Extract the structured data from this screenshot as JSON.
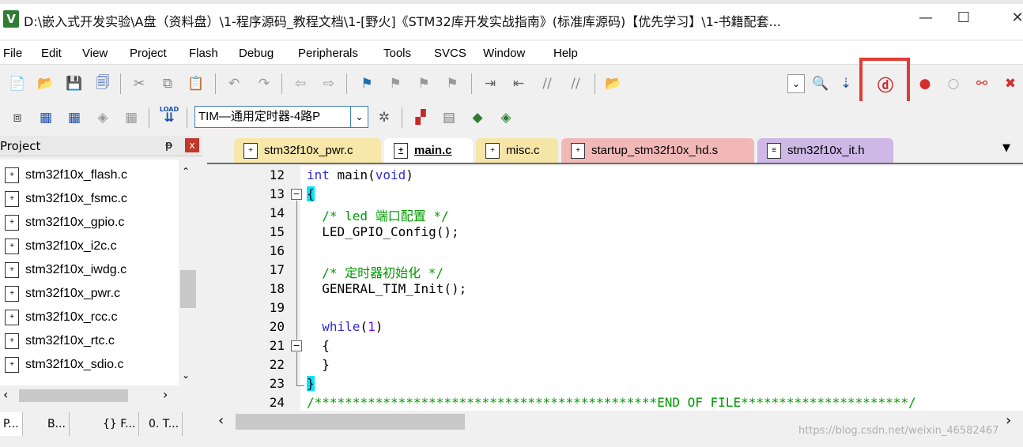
{
  "app_title": "D:\\嵌入式开发实验\\A盘（资料盘）\\1-程序源码_教程文档\\1-[野火]《STM32库开发实战指南》(标准库源码)【优先学习】\\1-书籍配套...",
  "app_icon_letter": "V",
  "window_controls": {
    "minimize": "—",
    "maximize": "☐",
    "close": "✕"
  },
  "menu": [
    "File",
    "Edit",
    "View",
    "Project",
    "Flash",
    "Debug",
    "Peripherals",
    "Tools",
    "SVCS",
    "Window",
    "Help"
  ],
  "toolbar2": {
    "load_label": "LOAD",
    "target_value": "TIM—通用定时器-4路P"
  },
  "project_panel": {
    "title": "Project",
    "pin": "ᵽ",
    "close": "x",
    "files": [
      "stm32f10x_flash.c",
      "stm32f10x_fsmc.c",
      "stm32f10x_gpio.c",
      "stm32f10x_i2c.c",
      "stm32f10x_iwdg.c",
      "stm32f10x_pwr.c",
      "stm32f10x_rcc.c",
      "stm32f10x_rtc.c",
      "stm32f10x_sdio.c"
    ],
    "tabs": [
      "P...",
      "B...",
      "{} F...",
      "0. T..."
    ]
  },
  "editor_tabs": [
    {
      "label": "stm32f10x_pwr.c",
      "color": "#f7e7a8"
    },
    {
      "label": "main.c",
      "color": "#ffffff"
    },
    {
      "label": "misc.c",
      "color": "#f5e6a8"
    },
    {
      "label": "startup_stm32f10x_hd.s",
      "color": "#f2b8b8"
    },
    {
      "label": "stm32f10x_it.h",
      "color": "#cdb8e6"
    }
  ],
  "code_lines": [
    {
      "n": "12",
      "parts": [
        {
          "t": "int",
          "c": "kw"
        },
        {
          "t": " main(",
          "c": "tx"
        },
        {
          "t": "void",
          "c": "kw"
        },
        {
          "t": ")",
          "c": "tx"
        }
      ]
    },
    {
      "n": "13",
      "parts": [
        {
          "t": "{",
          "c": "br"
        }
      ]
    },
    {
      "n": "14",
      "parts": [
        {
          "t": "  /* led 端口配置 */",
          "c": "cm"
        }
      ]
    },
    {
      "n": "15",
      "parts": [
        {
          "t": "  LED_GPIO_Config();",
          "c": "tx"
        }
      ]
    },
    {
      "n": "16",
      "parts": []
    },
    {
      "n": "17",
      "parts": [
        {
          "t": "  /* 定时器初始化 */",
          "c": "cm"
        }
      ]
    },
    {
      "n": "18",
      "parts": [
        {
          "t": "  GENERAL_TIM_Init();",
          "c": "tx"
        }
      ]
    },
    {
      "n": "19",
      "parts": []
    },
    {
      "n": "20",
      "parts": [
        {
          "t": "  while",
          "c": "kw"
        },
        {
          "t": "(",
          "c": "tx"
        },
        {
          "t": "1",
          "c": "num"
        },
        {
          "t": ")",
          "c": "tx"
        }
      ]
    },
    {
      "n": "21",
      "parts": [
        {
          "t": "  {",
          "c": "tx"
        }
      ]
    },
    {
      "n": "22",
      "parts": [
        {
          "t": "  }",
          "c": "tx"
        }
      ]
    },
    {
      "n": "23",
      "parts": [
        {
          "t": "}",
          "c": "br"
        }
      ]
    },
    {
      "n": "24",
      "parts": [
        {
          "t": "/*********************************************END OF FILE**********************/",
          "c": "cm"
        }
      ]
    }
  ],
  "colors": {
    "kw": "#2d2dd2",
    "tx": "#000000",
    "cm": "#009b00",
    "num": "#7f00ff",
    "br_bg": "#00e5ff",
    "highlight": "#e23b32"
  },
  "watermark": "https://blog.csdn.net/weixin_46582467"
}
